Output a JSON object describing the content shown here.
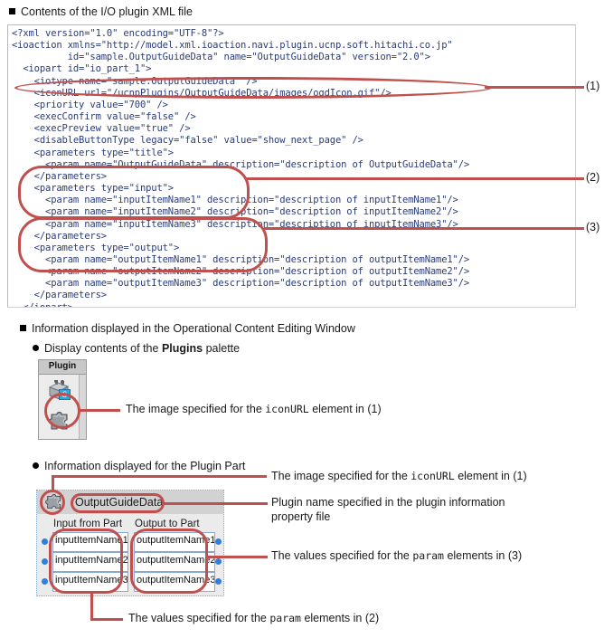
{
  "sections": {
    "xml_heading": "Contents of the I/O plugin XML file",
    "info_heading": "Information displayed in the Operational Content Editing Window",
    "palette_bullet_pre": "Display contents of the ",
    "palette_bullet_bold": "Plugins",
    "palette_bullet_post": " palette",
    "plugin_part_bullet": "Information displayed for the Plugin Part"
  },
  "xml": {
    "code": "<?xml version=\"1.0\" encoding=\"UTF-8\"?>\n<ioaction xmlns=\"http://model.xml.ioaction.navi.plugin.ucnp.soft.hitachi.co.jp\"\n          id=\"sample.OutputGuideData\" name=\"OutputGuideData\" version=\"2.0\">\n  <iopart id=\"io_part_1\">\n    <iotype name=\"sample.OutputGuideData\" />\n    <iconURL url=\"/ucnpPlugins/OutputGuideData/images/ogdIcon.gif\"/>\n    <priority value=\"700\" />\n    <execConfirm value=\"false\" />\n    <execPreview value=\"true\" />\n    <disableButtonType legacy=\"false\" value=\"show_next_page\" />\n    <parameters type=\"title\">\n      <param name=\"OutputGuideData\" description=\"description of OutputGuideData\"/>\n    </parameters>\n    <parameters type=\"input\">\n      <param name=\"inputItemName1\" description=\"description of inputItemName1\"/>\n      <param name=\"inputItemName2\" description=\"description of inputItemName2\"/>\n      <param name=\"inputItemName3\" description=\"description of inputItemName3\"/>\n    </parameters>\n    <parameters type=\"output\">\n      <param name=\"outputItemName1\" description=\"description of outputItemName1\"/>\n      <param name=\"outputItemName2\" description=\"description of outputItemName2\"/>\n      <param name=\"outputItemName3\" description=\"description of outputItemName3\"/>\n    </parameters>\n  </iopart>\n</ioaction>"
  },
  "refs": {
    "one": "(1)",
    "two": "(2)",
    "three": "(3)"
  },
  "callouts": {
    "palette_icon": {
      "pre": "The image specified for the ",
      "mono": "iconURL",
      "post": " element in (1)"
    },
    "part_icon": {
      "pre": "The image specified for the ",
      "mono": "iconURL",
      "post": " element in (1)"
    },
    "plugin_name_line1": "Plugin name specified in the plugin information",
    "plugin_name_line2": "property file",
    "output_values": {
      "pre": "The values specified for the ",
      "mono": "param",
      "post": " elements in (3)"
    },
    "input_values": {
      "pre": "The values specified for the ",
      "mono": "param",
      "post": " elements in (2)"
    }
  },
  "palette": {
    "tab_label": "Plugin",
    "badge_letter": "S"
  },
  "plugin_part": {
    "title": "OutputGuideData",
    "input_column_header": "Input from Part",
    "output_column_header": "Output to Part",
    "input_items": [
      "inputItemName1",
      "inputItemName2",
      "inputItemName3"
    ],
    "output_items": [
      "outputItemName1",
      "outputItemName2",
      "outputItemName3"
    ]
  },
  "colors": {
    "annotation_red": "#c0504d",
    "xml_text": "#2b3c78",
    "port_blue": "#2f7fdc",
    "badge_blue": "#2fa8dd"
  }
}
